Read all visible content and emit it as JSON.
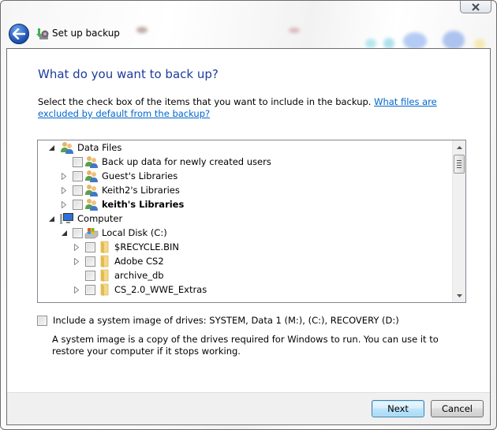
{
  "window": {
    "title": "Set up backup",
    "back_icon": "back-arrow-icon",
    "app_icon": "backup-icon",
    "close_icon": "close-icon"
  },
  "page": {
    "heading": "What do you want to back up?",
    "instructions": "Select the check box of the items that you want to include in the backup. ",
    "help_link": "What files are excluded by default from the backup?"
  },
  "tree": {
    "items": [
      {
        "label": "Data Files",
        "level": 0,
        "expander": "expanded",
        "checkbox": false,
        "icon": "users-icon",
        "bold": false
      },
      {
        "label": "Back up data for newly created users",
        "level": 1,
        "expander": "none",
        "checkbox": true,
        "checked": false,
        "icon": "users-icon",
        "bold": false
      },
      {
        "label": "Guest's Libraries",
        "level": 1,
        "expander": "collapsed",
        "checkbox": true,
        "checked": false,
        "icon": "users-icon",
        "bold": false
      },
      {
        "label": "Keith2's Libraries",
        "level": 1,
        "expander": "collapsed",
        "checkbox": true,
        "checked": false,
        "icon": "users-icon",
        "bold": false
      },
      {
        "label": "keith's Libraries",
        "level": 1,
        "expander": "collapsed",
        "checkbox": true,
        "checked": false,
        "icon": "users-icon",
        "bold": true
      },
      {
        "label": "Computer",
        "level": 0,
        "expander": "expanded",
        "checkbox": false,
        "icon": "computer-icon",
        "bold": false
      },
      {
        "label": "Local Disk (C:)",
        "level": 1,
        "expander": "expanded",
        "checkbox": true,
        "checked": false,
        "icon": "drive-icon",
        "bold": false
      },
      {
        "label": "$RECYCLE.BIN",
        "level": 2,
        "expander": "collapsed",
        "checkbox": true,
        "checked": false,
        "icon": "folder-icon",
        "bold": false
      },
      {
        "label": "Adobe CS2",
        "level": 2,
        "expander": "collapsed",
        "checkbox": true,
        "checked": false,
        "icon": "folder-icon",
        "bold": false
      },
      {
        "label": "archive_db",
        "level": 2,
        "expander": "none",
        "checkbox": true,
        "checked": false,
        "icon": "folder-icon",
        "bold": false
      },
      {
        "label": "CS_2.0_WWE_Extras",
        "level": 2,
        "expander": "collapsed",
        "checkbox": true,
        "checked": false,
        "icon": "folder-icon",
        "bold": false
      }
    ]
  },
  "system_image": {
    "checkbox_label": "Include a system image of drives: SYSTEM, Data 1 (M:), (C:), RECOVERY (D:)",
    "checked": false,
    "description": "A system image is a copy of the drives required for Windows to run. You can use it to restore your computer if it stops working."
  },
  "footer": {
    "next_label": "Next",
    "cancel_label": "Cancel"
  },
  "colors": {
    "heading": "#1e3a9c",
    "link": "#0066cc",
    "default_button": "#bee6fd"
  }
}
